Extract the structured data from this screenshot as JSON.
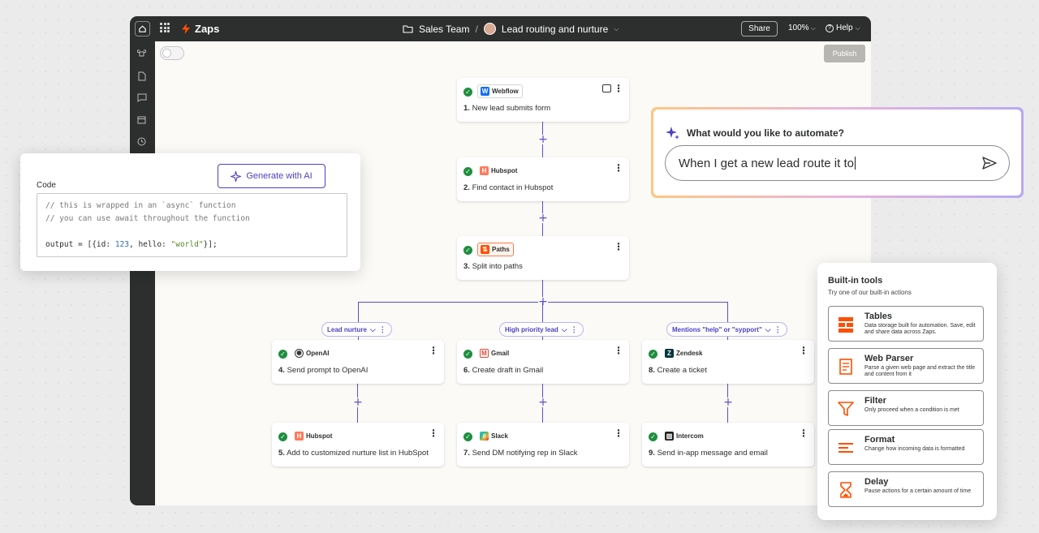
{
  "topbar": {
    "app_name": "Zaps",
    "folder": "Sales Team",
    "separator": "/",
    "zap_name": "Lead routing and nurture",
    "share_label": "Share",
    "zoom": "100%",
    "help_label": "Help"
  },
  "canvas": {
    "publish_label": "Publish"
  },
  "steps": [
    {
      "num": "1.",
      "app": "Webflow",
      "title": "New lead submits form"
    },
    {
      "num": "2.",
      "app": "Hubspot",
      "title": "Find contact in Hubspot"
    },
    {
      "num": "3.",
      "app": "Paths",
      "title": "Split into paths"
    },
    {
      "num": "4.",
      "app": "OpenAI",
      "title": "Send prompt to OpenAI"
    },
    {
      "num": "5.",
      "app": "Hubspot",
      "title": "Add to customized nurture list in HubSpot"
    },
    {
      "num": "6.",
      "app": "Gmail",
      "title": "Create draft in Gmail"
    },
    {
      "num": "7.",
      "app": "Slack",
      "title": "Send DM notifying rep in Slack"
    },
    {
      "num": "8.",
      "app": "Zendesk",
      "title": "Create a ticket"
    },
    {
      "num": "9.",
      "app": "Intercom",
      "title": "Send in-app message and email"
    }
  ],
  "branches": [
    "Lead nurture",
    "High priority lead",
    "Mentions \"help\" or \"sypport\""
  ],
  "code_panel": {
    "generate_label": "Generate with AI",
    "label": "Code",
    "line1": "// this is wrapped in an `async` function",
    "line2": "// you can use await throughout the function",
    "line3_a": "output = [{",
    "line3_b": "id:",
    "line3_c": "123",
    "line3_d": ", hello:",
    "line3_e": "\"world\"",
    "line3_f": "}];"
  },
  "ai_prompt": {
    "question": "What would you like to automate?",
    "input_value": "When I get a new lead route it to"
  },
  "tools": {
    "heading": "Built-in tools",
    "subheading": "Try one of our built-in actions",
    "items": [
      {
        "name": "Tables",
        "desc": "Data storage built for automation. Save, edit and share data across Zaps.",
        "icon": "tables-icon"
      },
      {
        "name": "Web Parser",
        "desc": "Parse a given web page and extract the title and content from it",
        "icon": "web-parser-icon"
      },
      {
        "name": "Filter",
        "desc": "Only proceed when a condition is met",
        "icon": "filter-icon"
      },
      {
        "name": "Format",
        "desc": "Change how incoming data is formatted",
        "icon": "format-icon"
      },
      {
        "name": "Delay",
        "desc": "Pause actions for a certain amount of time",
        "icon": "delay-icon"
      }
    ]
  },
  "colors": {
    "accent": "#4b41c4",
    "brand": "#ff4f00",
    "success": "#1e8e3e"
  }
}
